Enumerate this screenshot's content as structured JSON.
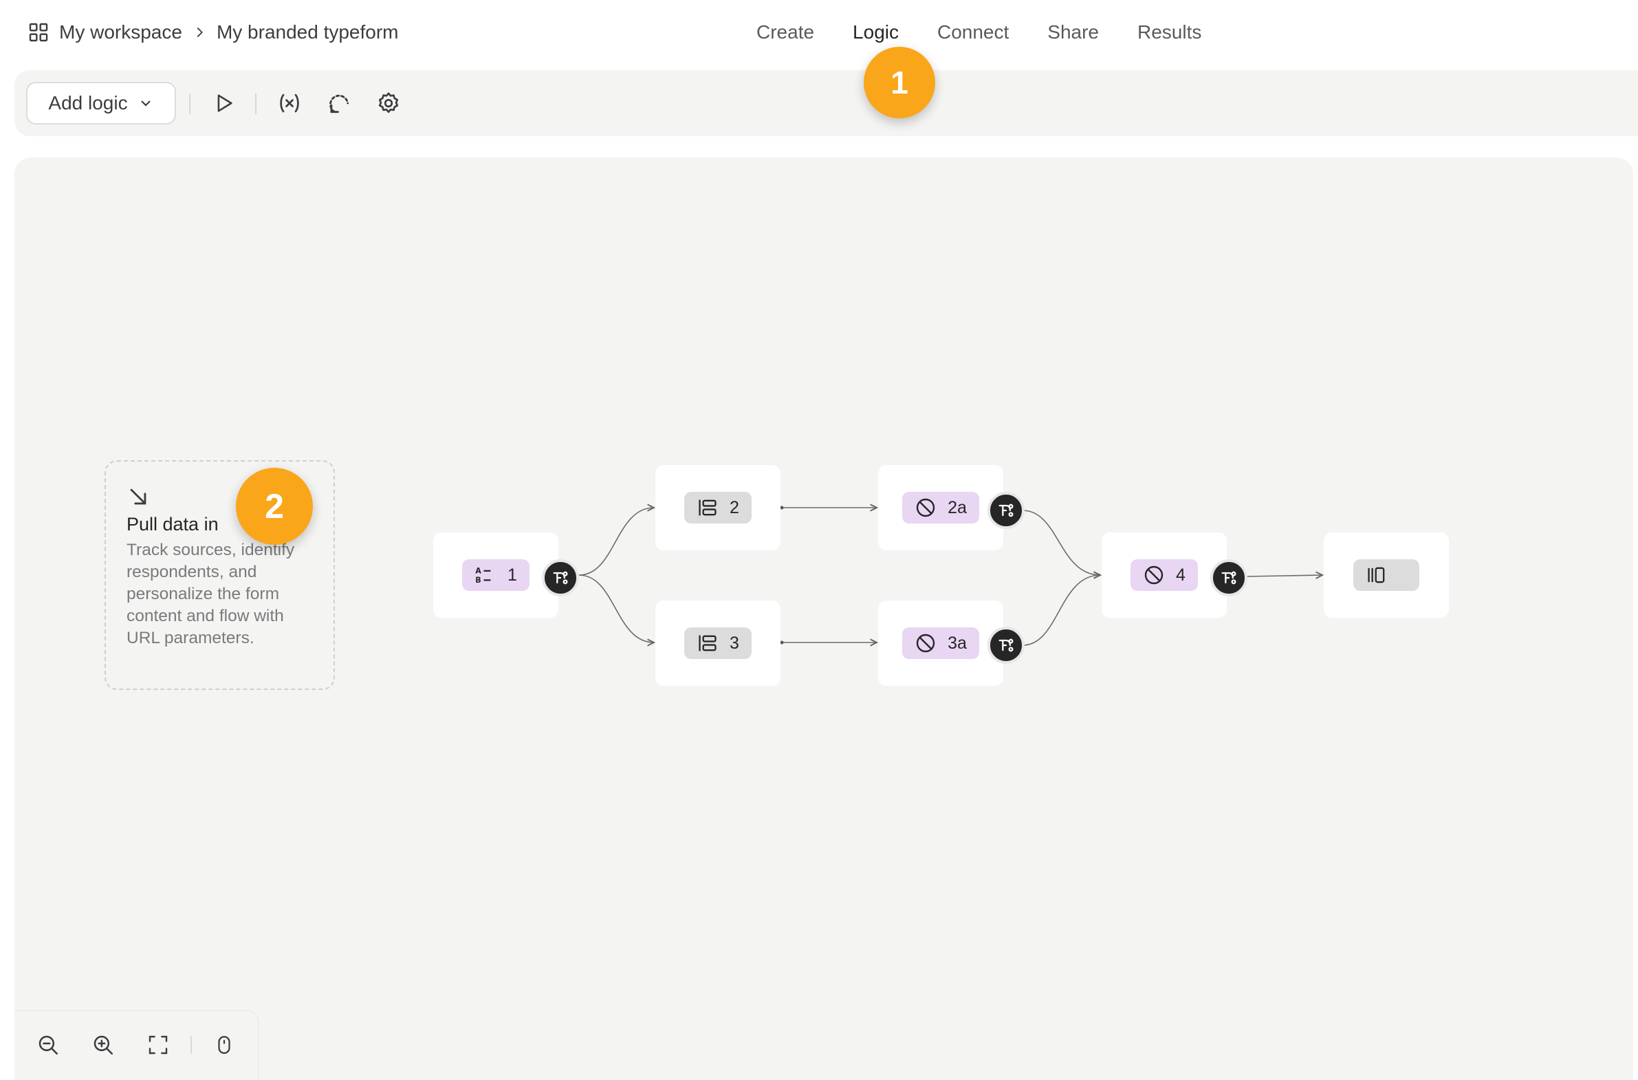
{
  "breadcrumb": {
    "workspace": "My workspace",
    "form": "My branded typeform"
  },
  "nav": {
    "tabs": [
      {
        "label": "Create"
      },
      {
        "label": "Logic",
        "active": true
      },
      {
        "label": "Connect"
      },
      {
        "label": "Share"
      },
      {
        "label": "Results"
      }
    ]
  },
  "badges": [
    "1",
    "2"
  ],
  "toolbar": {
    "add_logic_label": "Add logic",
    "icons": [
      "play-icon",
      "variables-icon",
      "logic-loop-icon",
      "settings-icon"
    ]
  },
  "pull_data": {
    "title": "Pull data in",
    "description": "Track sources, identify respondents, and personalize the form content and flow with URL parameters."
  },
  "flow": {
    "nodes": [
      {
        "id": "n1",
        "label": "1",
        "type": "multiple-choice",
        "color": "purple"
      },
      {
        "id": "n2",
        "label": "2",
        "type": "question-group",
        "color": "gray"
      },
      {
        "id": "n3",
        "label": "3",
        "type": "question-group",
        "color": "gray"
      },
      {
        "id": "n2a",
        "label": "2a",
        "type": "no-answer",
        "color": "purple"
      },
      {
        "id": "n3a",
        "label": "3a",
        "type": "no-answer",
        "color": "purple"
      },
      {
        "id": "n4",
        "label": "4",
        "type": "no-answer",
        "color": "purple"
      },
      {
        "id": "end",
        "label": "",
        "type": "ending",
        "color": "gray"
      }
    ]
  },
  "colors": {
    "accent_badge": "#f9a61a",
    "purple_pill": "#e8d6f3",
    "gray_pill": "#dcdcdc",
    "canvas": "#f4f4f3"
  }
}
